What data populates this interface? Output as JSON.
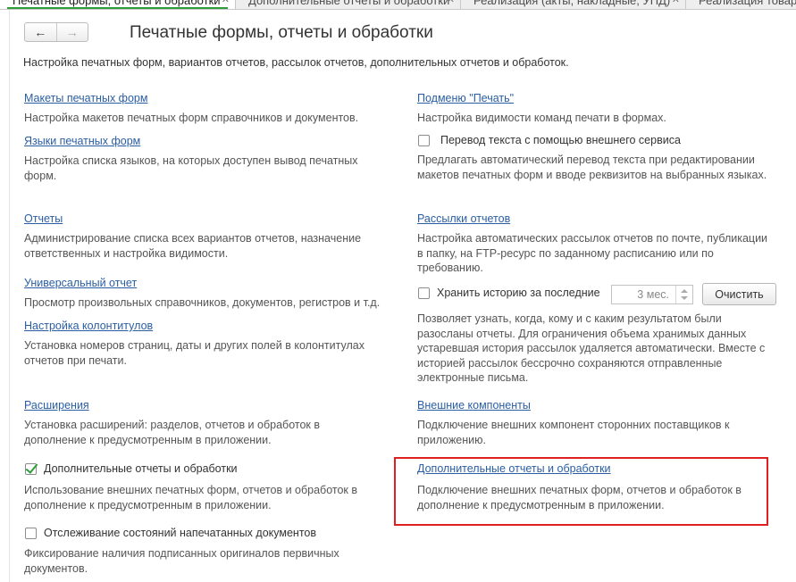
{
  "tabs": [
    {
      "label": "Печатные формы, отчеты и обработки",
      "active": true
    },
    {
      "label": "Дополнительные отчеты и обработки",
      "active": false
    },
    {
      "label": "Реализация (акты, накладные, УПД)",
      "active": false
    },
    {
      "label": "Реализация товаров",
      "active": false
    }
  ],
  "nav": {
    "back_icon": "←",
    "forward_icon": "→"
  },
  "page": {
    "title": "Печатные формы, отчеты и обработки",
    "subtitle": "Настройка печатных форм, вариантов отчетов, рассылок отчетов, дополнительных отчетов и обработок."
  },
  "left": {
    "layouts": {
      "link": "Макеты печатных форм",
      "desc": "Настройка макетов печатных форм справочников и документов."
    },
    "languages": {
      "link": "Языки печатных форм",
      "desc": "Настройка списка языков, на которых доступен вывод печатных форм."
    },
    "reports": {
      "link": "Отчеты",
      "desc": "Администрирование списка всех вариантов отчетов, назначение ответственных и настройка видимости."
    },
    "universal": {
      "link": "Универсальный отчет",
      "desc": "Просмотр произвольных справочников, документов, регистров и т.д."
    },
    "headers": {
      "link": "Настройка колонтитулов",
      "desc": "Установка номеров страниц, даты и других полей в колонтитулах отчетов при печати."
    },
    "extensions": {
      "link": "Расширения",
      "desc": "Установка расширений: разделов, отчетов и обработок в дополнение к предусмотренным в приложении."
    },
    "additional": {
      "label": "Дополнительные отчеты и обработки",
      "checked": true,
      "desc": "Использование внешних печатных форм, отчетов и обработок в дополнение к предусмотренным в приложении."
    },
    "tracking": {
      "label": "Отслеживание состояний напечатанных документов",
      "checked": false,
      "desc": "Фиксирование наличия подписанных оригиналов первичных документов."
    }
  },
  "right": {
    "print_submenu": {
      "link": "Подменю \"Печать\"",
      "desc": "Настройка видимости команд печати в формах."
    },
    "translation": {
      "label": "Перевод текста с помощью внешнего сервиса",
      "checked": false,
      "desc": "Предлагать автоматический перевод текста при редактировании макетов печатных форм и вводе реквизитов на выбранных языках."
    },
    "mailings": {
      "link": "Рассылки отчетов",
      "desc": "Настройка автоматических рассылок отчетов по почте, публикации в папку, на FTP-ресурс по заданному расписанию или по требованию."
    },
    "history": {
      "label": "Хранить историю за последние",
      "checked": false,
      "value": "3 мес.",
      "clear_button": "Очистить",
      "desc": "Позволяет узнать, когда, кому и с каким результатом были разосланы отчеты. Для ограничения объема хранимых данных устаревшая история рассылок удаляется автоматически. Вместе с историей рассылок бессрочно сохраняются отправленные электронные письма."
    },
    "components": {
      "link": "Внешние компоненты",
      "desc": "Подключение внешних компонент сторонних поставщиков к приложению."
    },
    "additional": {
      "link": "Дополнительные отчеты и обработки",
      "desc": "Подключение внешних печатных форм, отчетов и обработок в дополнение к предусмотренным в приложении."
    }
  },
  "colors": {
    "link": "#2a5ea3",
    "accent": "#2d9d3a",
    "highlight": "#e02020"
  }
}
